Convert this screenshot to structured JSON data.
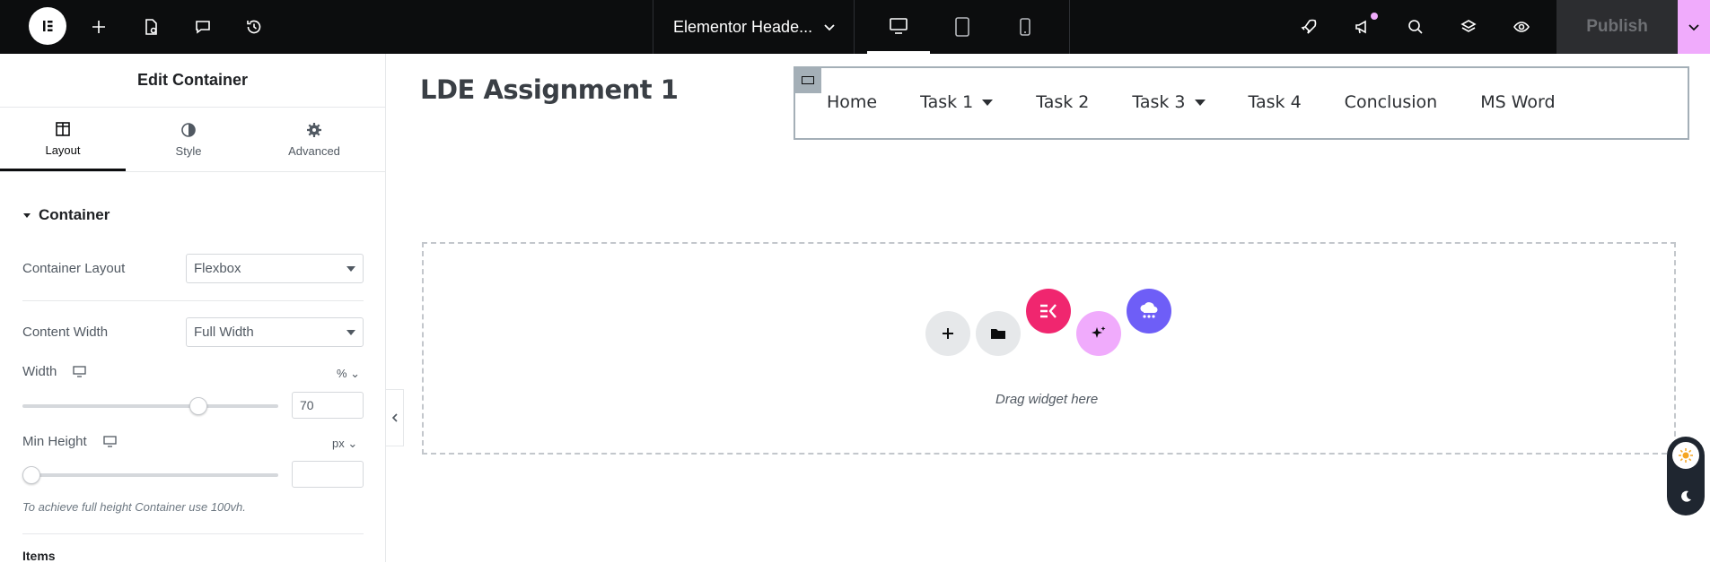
{
  "topbar": {
    "document_title": "Elementor Heade...",
    "publish_label": "Publish",
    "accent_color": "#f0abfc"
  },
  "panel": {
    "title": "Edit Container",
    "tabs": [
      {
        "label": "Layout",
        "icon": "layout-icon"
      },
      {
        "label": "Style",
        "icon": "half-circle-icon"
      },
      {
        "label": "Advanced",
        "icon": "gear-icon"
      }
    ],
    "active_tab": "Layout",
    "section_title": "Container",
    "container_layout_label": "Container Layout",
    "container_layout_value": "Flexbox",
    "content_width_label": "Content Width",
    "content_width_value": "Full Width",
    "width_label": "Width",
    "width_unit": "%",
    "width_value": "70",
    "width_slider_fraction": 0.7,
    "min_height_label": "Min Height",
    "min_height_unit": "px",
    "min_height_value": "",
    "min_height_slider_fraction": 0,
    "hint": "To achieve full height Container use 100vh.",
    "items_label": "Items"
  },
  "canvas": {
    "site_title": "LDE Assignment 1",
    "nav_items": [
      {
        "label": "Home",
        "dropdown": false
      },
      {
        "label": "Task 1",
        "dropdown": true
      },
      {
        "label": "Task 2",
        "dropdown": false
      },
      {
        "label": "Task 3",
        "dropdown": true
      },
      {
        "label": "Task 4",
        "dropdown": false
      },
      {
        "label": "Conclusion",
        "dropdown": false
      },
      {
        "label": "MS Word",
        "dropdown": false
      }
    ],
    "dropzone_text": "Drag widget here"
  }
}
